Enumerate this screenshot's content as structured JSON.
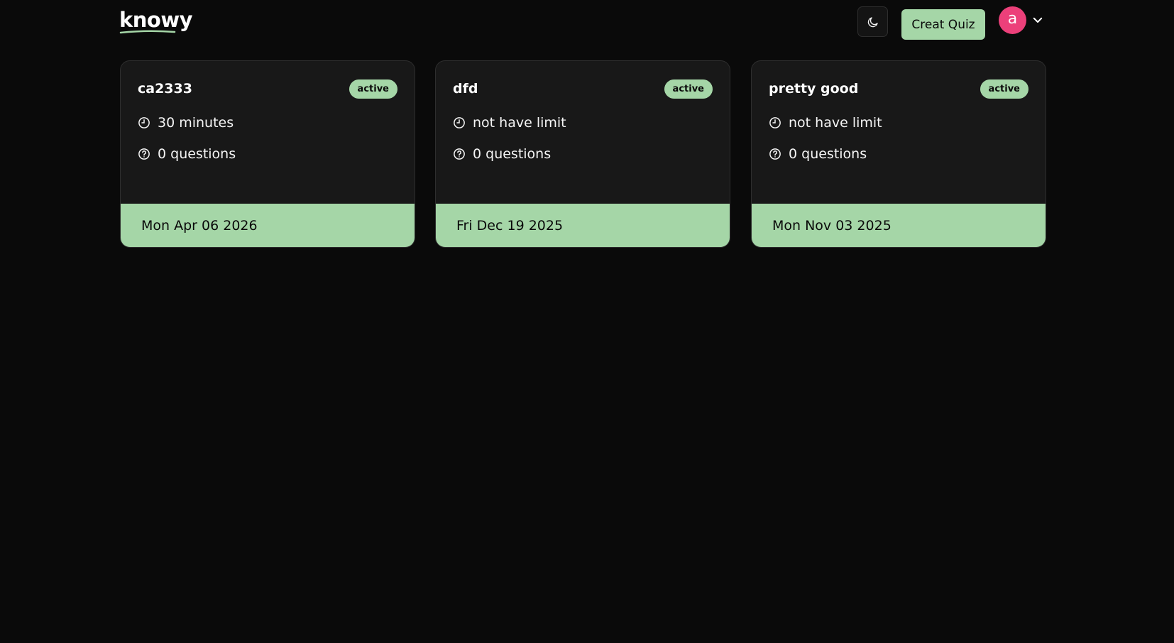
{
  "header": {
    "logo_text": "knowy",
    "theme_icon": "moon-icon",
    "create_label": "Creat Quiz",
    "avatar_letter": "a",
    "avatar_color": "#ec407a",
    "chevron_icon": "chevron-down-icon"
  },
  "colors": {
    "background": "#0a0a0a",
    "card": "#181818",
    "accent": "#a5d6a7"
  },
  "quizzes": [
    {
      "title": "ca2333",
      "status": "active",
      "time_icon": "clock-icon",
      "time_limit": "30 minutes",
      "questions_icon": "question-circle-icon",
      "questions": "0 questions",
      "date": "Mon Apr 06 2026"
    },
    {
      "title": "dfd",
      "status": "active",
      "time_icon": "clock-icon",
      "time_limit": "not have limit",
      "questions_icon": "question-circle-icon",
      "questions": "0 questions",
      "date": "Fri Dec 19 2025"
    },
    {
      "title": "pretty good",
      "status": "active",
      "time_icon": "clock-icon",
      "time_limit": "not have limit",
      "questions_icon": "question-circle-icon",
      "questions": "0 questions",
      "date": "Mon Nov 03 2025"
    }
  ]
}
